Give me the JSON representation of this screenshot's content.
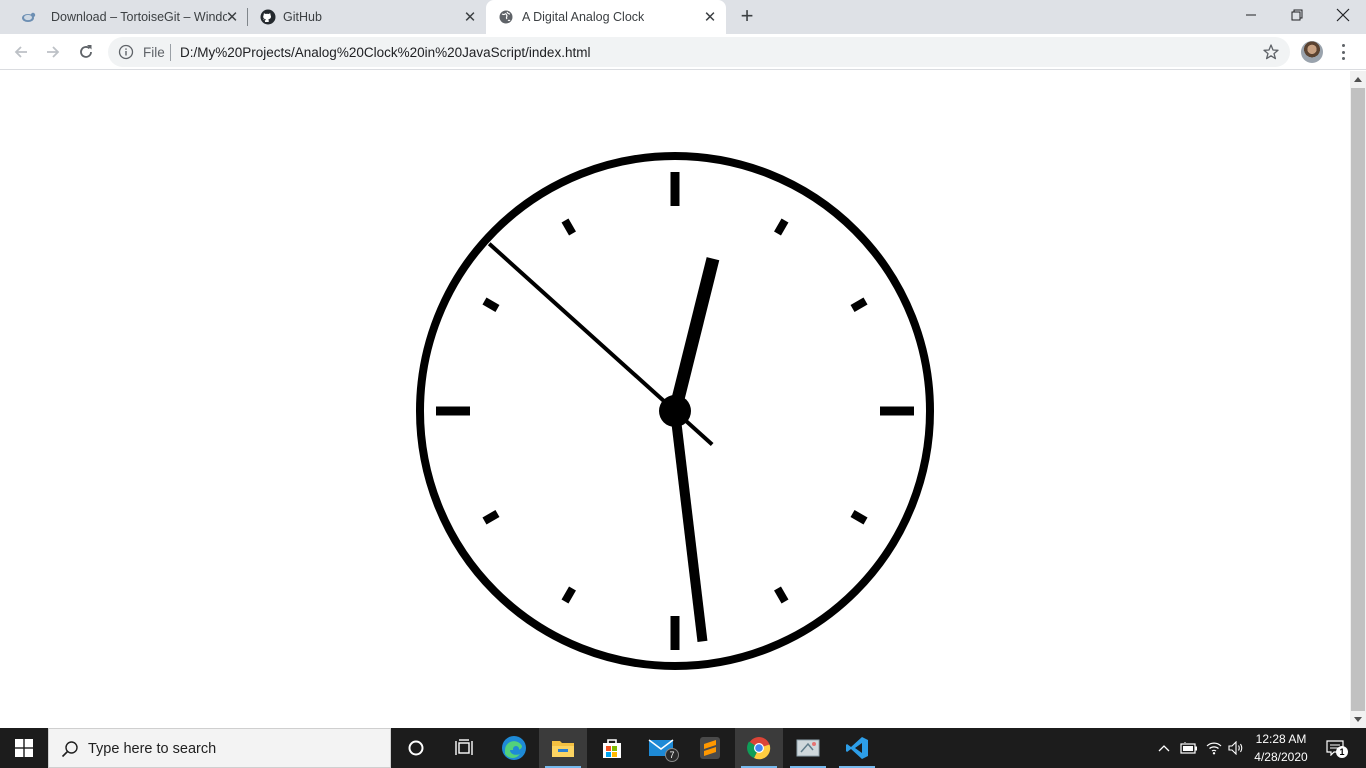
{
  "tabs": [
    {
      "title": "Download – TortoiseGit – Windows Shell Interface to Git",
      "icon": "tortoise-icon",
      "active": false
    },
    {
      "title": "GitHub",
      "icon": "github-icon",
      "active": false
    },
    {
      "title": "A Digital Analog Clock",
      "icon": "globe-icon",
      "active": true
    }
  ],
  "toolbar": {
    "file_label": "File",
    "url": "D:/My%20Projects/Analog%20Clock%20in%20JavaScript/index.html"
  },
  "clock": {
    "hour": 12,
    "minute": 28,
    "second": 52,
    "face_color": "#ffffff",
    "ink_color": "#000000"
  },
  "taskbar": {
    "search_placeholder": "Type here to search",
    "mail_badge": "7",
    "time": "12:28 AM",
    "date": "4/28/2020",
    "notification_count": "1",
    "accent": "#76b9ed"
  }
}
